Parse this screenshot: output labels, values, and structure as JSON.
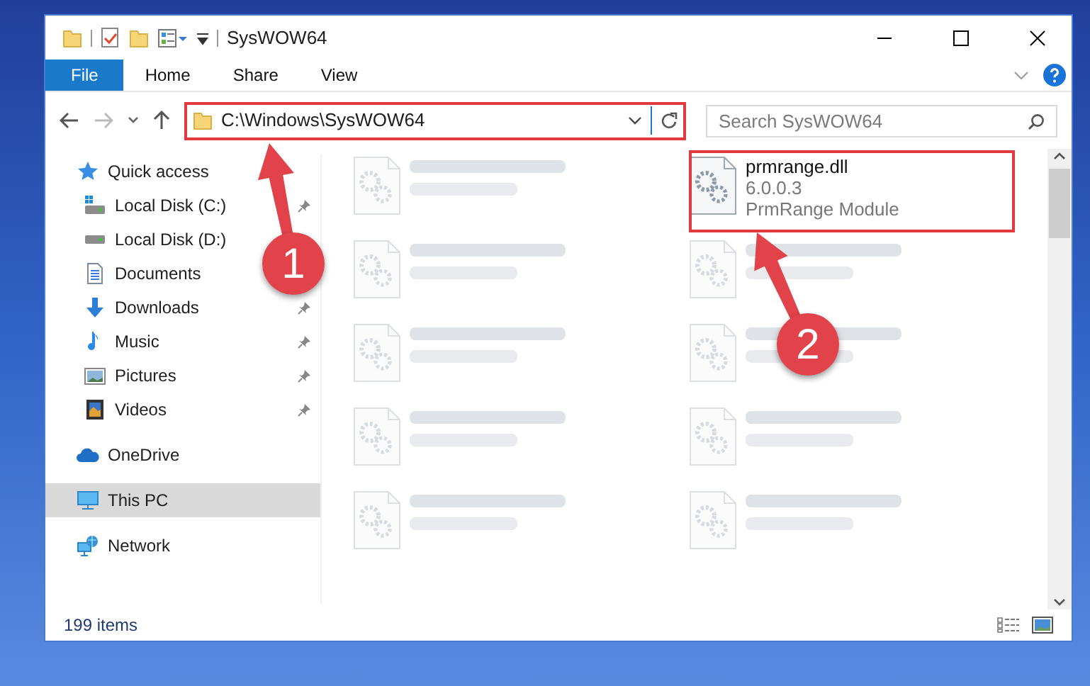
{
  "window": {
    "title": "SysWOW64"
  },
  "ribbon_tabs": [
    {
      "label": "File",
      "selected": true
    },
    {
      "label": "Home",
      "selected": false
    },
    {
      "label": "Share",
      "selected": false
    },
    {
      "label": "View",
      "selected": false
    }
  ],
  "address": {
    "path": "C:\\Windows\\SysWOW64"
  },
  "search": {
    "placeholder": "Search SysWOW64"
  },
  "sidebar": {
    "items": [
      {
        "label": "Quick access",
        "kind": "star",
        "selected": false,
        "children": [
          {
            "label": "Local Disk (C:)",
            "kind": "disk-c",
            "selected": false,
            "pinned": true
          },
          {
            "label": "Local Disk (D:)",
            "kind": "disk",
            "selected": false,
            "pinned": false
          },
          {
            "label": "Documents",
            "kind": "documents",
            "selected": false,
            "pinned": false
          },
          {
            "label": "Downloads",
            "kind": "downloads",
            "selected": false,
            "pinned": true
          },
          {
            "label": "Music",
            "kind": "music",
            "selected": false,
            "pinned": true
          },
          {
            "label": "Pictures",
            "kind": "pictures",
            "selected": false,
            "pinned": true
          },
          {
            "label": "Videos",
            "kind": "videos",
            "selected": false,
            "pinned": true
          }
        ]
      },
      {
        "label": "OneDrive",
        "kind": "cloud",
        "selected": false
      },
      {
        "label": "This PC",
        "kind": "pc",
        "selected": true
      },
      {
        "label": "Network",
        "kind": "network",
        "selected": false
      }
    ]
  },
  "files": [
    {
      "kind": "blurred"
    },
    {
      "kind": "file",
      "name": "prmrange.dll",
      "details": [
        "6.0.0.3",
        "PrmRange Module"
      ]
    },
    {
      "kind": "blurred"
    },
    {
      "kind": "blurred"
    },
    {
      "kind": "blurred"
    },
    {
      "kind": "blurred"
    },
    {
      "kind": "blurred"
    },
    {
      "kind": "blurred"
    },
    {
      "kind": "blurred"
    },
    {
      "kind": "blurred"
    }
  ],
  "status_bar": {
    "item_count": "199 items"
  },
  "annotations": [
    {
      "label": "1"
    },
    {
      "label": "2"
    }
  ]
}
